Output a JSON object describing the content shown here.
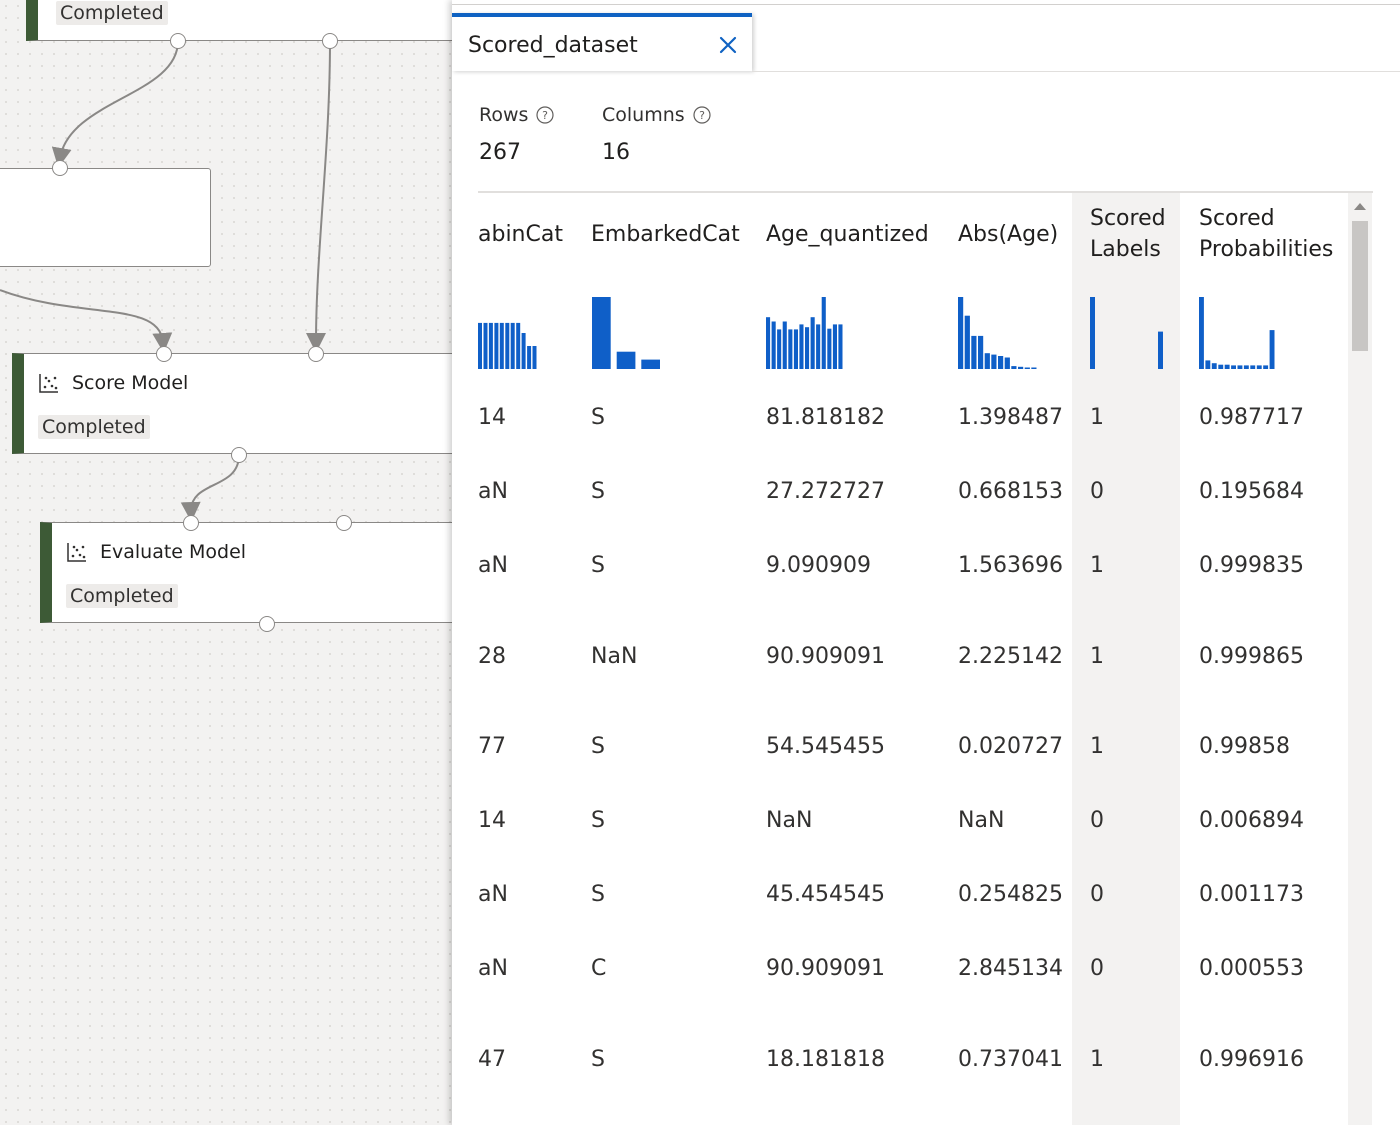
{
  "canvas": {
    "top_node_status": "Completed",
    "score_model": {
      "title": "Score Model",
      "status": "Completed"
    },
    "evaluate_model": {
      "title": "Evaluate Model",
      "status": "Completed"
    },
    "colors": {
      "node_accent": "#3d5a36",
      "wire": "#8a8886"
    }
  },
  "panel": {
    "tab_title": "Scored_dataset",
    "close_icon": "close-icon",
    "rows_label": "Rows",
    "rows_value": "267",
    "columns_label": "Columns",
    "columns_value": "16",
    "accent_color": "#0f62c2",
    "histogram_color": "#0f5fc8"
  },
  "table": {
    "columns": [
      {
        "header": "abinCat",
        "hist": [
          0.64,
          0.64,
          0.64,
          0.64,
          0.64,
          0.64,
          0.64,
          0.64,
          0.5,
          0.32,
          0.32
        ]
      },
      {
        "header": "EmbarkedCat",
        "hist": [
          1.0,
          0.24,
          0.13
        ]
      },
      {
        "header": "Age_quantized",
        "hist": [
          0.72,
          0.66,
          0.55,
          0.66,
          0.55,
          0.55,
          0.62,
          0.58,
          0.72,
          0.62,
          1.0,
          0.56,
          0.62,
          0.62
        ]
      },
      {
        "header": "Abs(Age)",
        "hist": [
          1.0,
          0.74,
          0.46,
          0.46,
          0.22,
          0.2,
          0.18,
          0.16,
          0.04,
          0.03,
          0.02,
          0.02
        ]
      },
      {
        "header_line1": "Scored",
        "header_line2": "Labels",
        "hist": [
          1.0,
          0.52
        ]
      },
      {
        "header_line1": "Scored",
        "header_line2": "Probabilities",
        "hist": [
          1.0,
          0.12,
          0.08,
          0.06,
          0.06,
          0.05,
          0.05,
          0.05,
          0.05,
          0.05,
          0.05,
          0.54
        ]
      }
    ],
    "rows": [
      [
        "14",
        "S",
        "81.818182",
        "1.398487",
        "1",
        "0.987717"
      ],
      [
        "aN",
        "S",
        "27.272727",
        "0.668153",
        "0",
        "0.195684"
      ],
      [
        "aN",
        "S",
        "9.090909",
        "1.563696",
        "1",
        "0.999835"
      ],
      [
        "28",
        "NaN",
        "90.909091",
        "2.225142",
        "1",
        "0.999865"
      ],
      [
        "77",
        "S",
        "54.545455",
        "0.020727",
        "1",
        "0.99858"
      ],
      [
        "14",
        "S",
        "NaN",
        "NaN",
        "0",
        "0.006894"
      ],
      [
        "aN",
        "S",
        "45.454545",
        "0.254825",
        "0",
        "0.001173"
      ],
      [
        "aN",
        "C",
        "90.909091",
        "2.845134",
        "0",
        "0.000553"
      ],
      [
        "47",
        "S",
        "18.181818",
        "0.737041",
        "1",
        "0.996916"
      ]
    ]
  }
}
